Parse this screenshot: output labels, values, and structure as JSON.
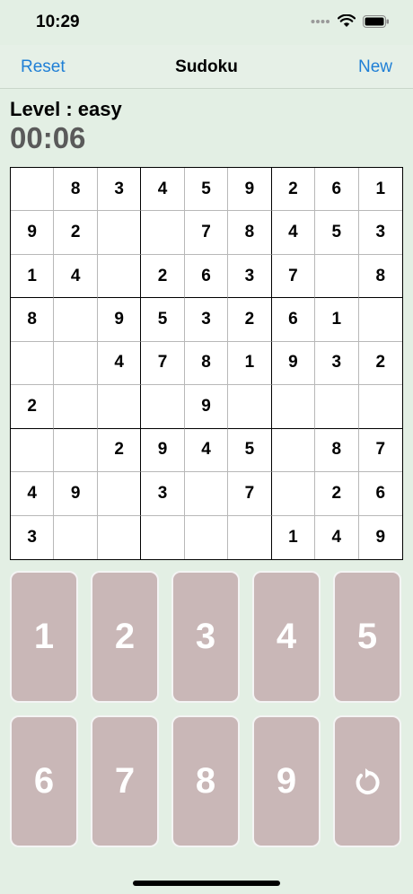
{
  "status": {
    "time": "10:29"
  },
  "nav": {
    "reset_label": "Reset",
    "title": "Sudoku",
    "new_label": "New"
  },
  "game": {
    "level_text": "Level : easy",
    "timer": "00:06"
  },
  "board": [
    [
      "",
      "8",
      "3",
      "4",
      "5",
      "9",
      "2",
      "6",
      "1"
    ],
    [
      "9",
      "2",
      "",
      "",
      "7",
      "8",
      "4",
      "5",
      "3"
    ],
    [
      "1",
      "4",
      "",
      "2",
      "6",
      "3",
      "7",
      "",
      "8"
    ],
    [
      "8",
      "",
      "9",
      "5",
      "3",
      "2",
      "6",
      "1",
      ""
    ],
    [
      "",
      "",
      "4",
      "7",
      "8",
      "1",
      "9",
      "3",
      "2"
    ],
    [
      "2",
      "",
      "",
      "",
      "9",
      "",
      "",
      "",
      ""
    ],
    [
      "",
      "",
      "2",
      "9",
      "4",
      "5",
      "",
      "8",
      "7"
    ],
    [
      "4",
      "9",
      "",
      "3",
      "",
      "7",
      "",
      "2",
      "6"
    ],
    [
      "3",
      "",
      "",
      "",
      "",
      "",
      "1",
      "4",
      "9"
    ]
  ],
  "keypad": {
    "keys": [
      "1",
      "2",
      "3",
      "4",
      "5",
      "6",
      "7",
      "8",
      "9"
    ],
    "undo_icon": "undo-icon"
  },
  "colors": {
    "background": "#e3efe4",
    "accent": "#1f7fd6",
    "key_fill": "#c9b7b7",
    "timer": "#5a5a5a"
  }
}
